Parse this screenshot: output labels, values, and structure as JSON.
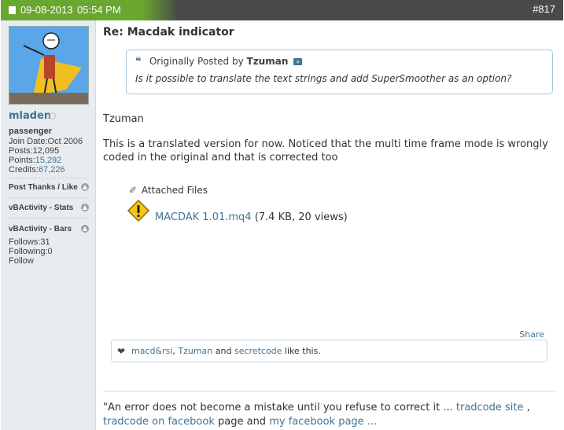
{
  "header": {
    "date": "09-08-2013",
    "time": "05:54 PM",
    "post_number": "#817"
  },
  "user": {
    "username": "mladen",
    "rank": "passenger",
    "join_date_label": "Join Date:",
    "join_date": "Oct 2006",
    "posts_label": "Posts:",
    "posts": "12,095",
    "points_label": "Points:",
    "points": "15,292",
    "credits_label": "Credits:",
    "credits": "67,226",
    "sections": [
      {
        "label": "Post Thanks / Like"
      },
      {
        "label": "vBActivity - Stats"
      },
      {
        "label": "vBActivity - Bars"
      }
    ],
    "follows_label": "Follows:",
    "follows": "31",
    "following_label": "Following:",
    "following": "0",
    "follow_link": "Follow"
  },
  "post": {
    "title": "Re: Macdak indicator",
    "quote": {
      "prefix": "Originally Posted by",
      "author": "Tzuman",
      "text": "Is it possible to translate the text strings and add SuperSmoother as an option?"
    },
    "greeting": "Tzuman",
    "body": "This is a translated version for now. Noticed that the multi time frame mode is wrongly coded in the original and that is corrected too",
    "attachments_label": "Attached Files",
    "attachment": {
      "name": "MACDAK 1.01.mq4",
      "meta": "(7.4 KB, 20 views)"
    }
  },
  "share_label": "Share",
  "likes": {
    "user1": "macd&rsi",
    "sep1": ",",
    "user2": "Tzuman",
    "and": "and",
    "user3": "secretcode",
    "suffix": "like this."
  },
  "signature": {
    "text1": "\"An error does not become a mistake until you refuse to correct it ...",
    "link1": "tradcode site",
    "sep": ",",
    "link2": "tradcode on facebook",
    "mid": "page and",
    "link3": "my facebook page ..."
  },
  "colors": {
    "header_bg": "#4a4a4a",
    "header_accent": "#6aa730",
    "link": "#417394",
    "sidebar_bg": "#e9ecef"
  }
}
